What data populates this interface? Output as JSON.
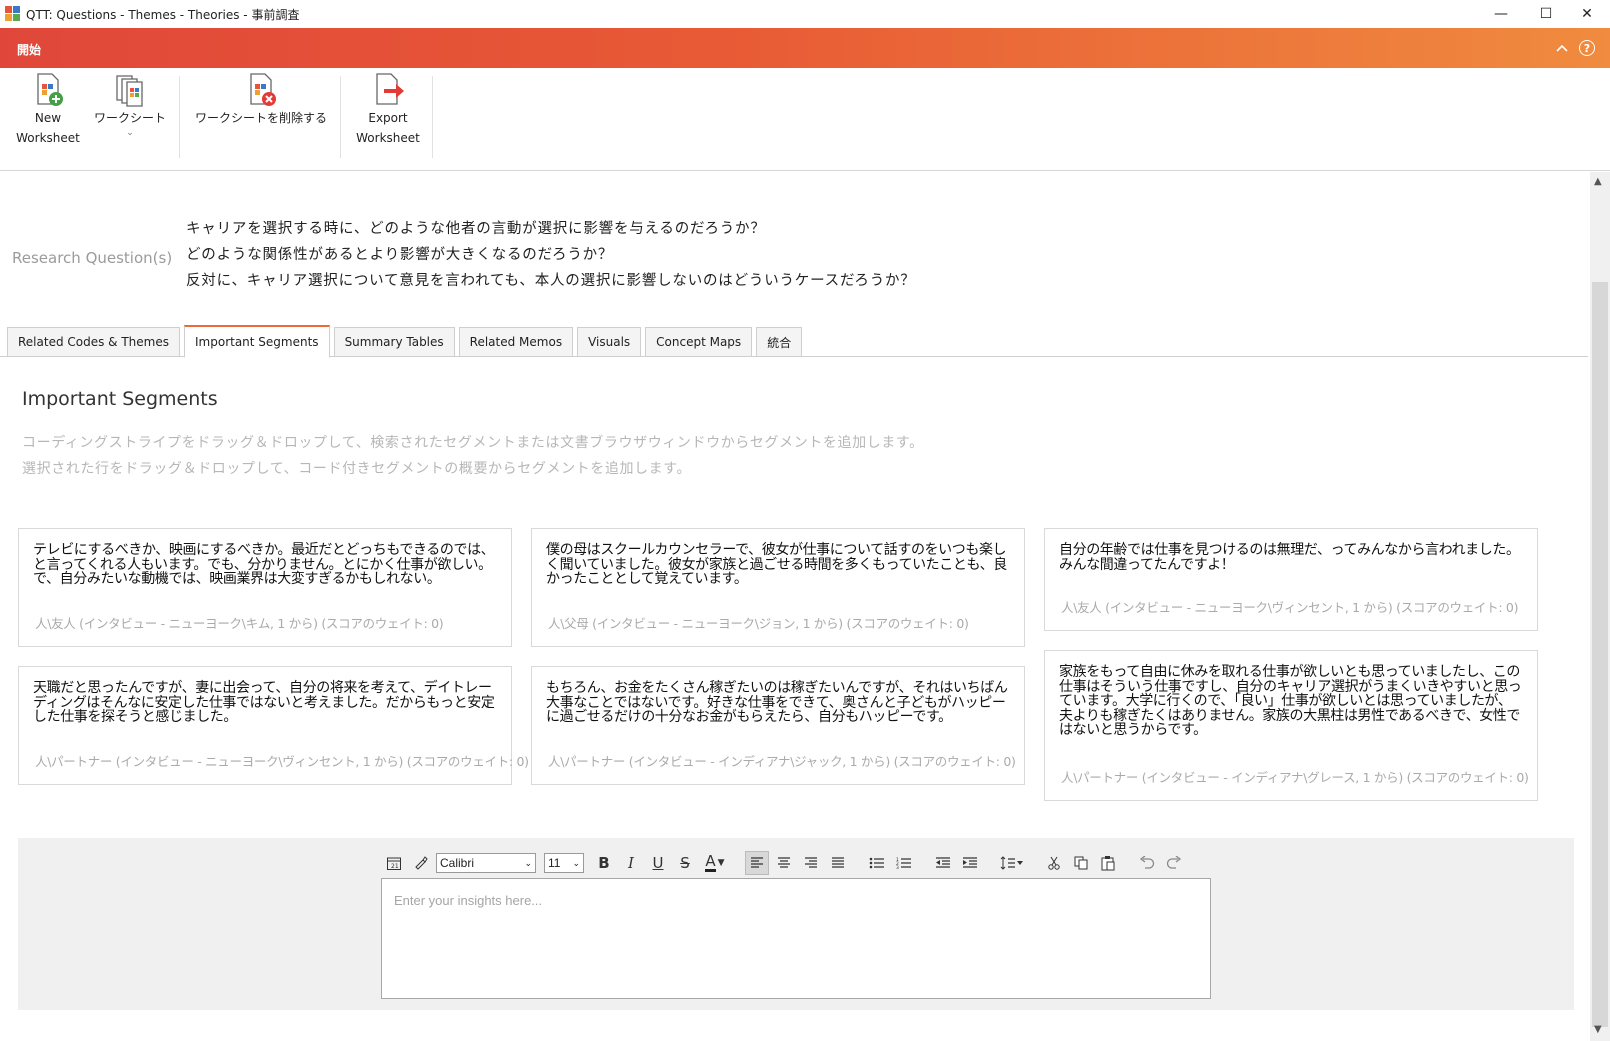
{
  "window": {
    "title": "QTT: Questions - Themes - Theories - 事前調査",
    "controls": {
      "minimize": "—",
      "maximize": "☐",
      "close": "✕"
    }
  },
  "ribbon": {
    "tab_label": "開始",
    "buttons": {
      "new_worksheet": {
        "line1": "New",
        "line2": "Worksheet"
      },
      "worksheet": {
        "line1": "ワークシート",
        "arrow": "⌄"
      },
      "delete_worksheet": {
        "line1": "ワークシートを削除する"
      },
      "export_worksheet": {
        "line1": "Export",
        "line2": "Worksheet"
      }
    }
  },
  "research": {
    "label": "Research Question(s)",
    "questions": [
      "キャリアを選択する時に、どのような他者の言動が選択に影響を与えるのだろうか？",
      "どのような関係性があるとより影響が大きくなるのだろうか？",
      "反対に、キャリア選択について意見を言われても、本人の選択に影響しないのはどういうケースだろうか？"
    ]
  },
  "tabs": [
    {
      "label": "Related Codes & Themes",
      "active": false
    },
    {
      "label": "Important Segments",
      "active": true
    },
    {
      "label": "Summary Tables",
      "active": false
    },
    {
      "label": "Related Memos",
      "active": false
    },
    {
      "label": "Visuals",
      "active": false
    },
    {
      "label": "Concept Maps",
      "active": false
    },
    {
      "label": "統合",
      "active": false
    }
  ],
  "segments": {
    "title": "Important Segments",
    "hint_lines": [
      "コーディングストライプをドラッグ＆ドロップして、検索されたセグメントまたは文書ブラウザウィンドウからセグメントを追加します。",
      "選択された行をドラッグ＆ドロップして、コード付きセグメントの概要からセグメントを追加します。"
    ],
    "cards": [
      {
        "text": "テレビにするべきか、映画にするべきか。最近だとどっちもできるのでは、と言ってくれる人もいます。でも、分かりません。とにかく仕事が欲しい。で、自分みたいな動機では、映画業界は大変すぎるかもしれない。",
        "source": "人\\友人 (インタビュー - ニューヨーク\\キム, 1 から) (スコアのウェイト: 0)"
      },
      {
        "text": "僕の母はスクールカウンセラーで、彼女が仕事について話すのをいつも楽しく聞いていました。彼女が家族と過ごせる時間を多くもっていたことも、良かったこととして覚えています。",
        "source": "人\\父母 (インタビュー - ニューヨーク\\ジョン, 1 から) (スコアのウェイト: 0)"
      },
      {
        "text": "自分の年齢では仕事を見つけるのは無理だ、ってみんなから言われました。みんな間違ってたんですよ！",
        "source": "人\\友人 (インタビュー - ニューヨーク\\ヴィンセント, 1 から) (スコアのウェイト: 0)"
      },
      {
        "text": "天職だと思ったんですが、妻に出会って、自分の将来を考えて、デイトレーディングはそんなに安定した仕事ではないと考えました。だからもっと安定した仕事を探そうと感じました。",
        "source": "人\\パートナー (インタビュー - ニューヨーク\\ヴィンセント, 1 から) (スコアのウェイト: 0)"
      },
      {
        "text": "もちろん、お金をたくさん稼ぎたいのは稼ぎたいんですが、それはいちばん大事なことではないです。好きな仕事をできて、奥さんと子どもがハッピーに過ごせるだけの十分なお金がもらえたら、自分もハッピーです。",
        "source": "人\\パートナー (インタビュー - インディアナ\\ジャック, 1 から) (スコアのウェイト: 0)"
      },
      {
        "text": "家族をもって自由に休みを取れる仕事が欲しいとも思っていましたし、この仕事はそういう仕事ですし、自分のキャリア選択がうまくいきやすいと思っています。大学に行くので、「良い」仕事が欲しいとは思っていましたが、夫よりも稼ぎたくはありません。家族の大黒柱は男性であるべきで、女性ではないと思うからです。",
        "source": "人\\パートナー (インタビュー - インディアナ\\グレース, 1 から) (スコアのウェイト: 0)"
      }
    ]
  },
  "editor": {
    "font_name": "Calibri",
    "font_size": "11",
    "placeholder": "Enter your insights here...",
    "icons": [
      "calendar-icon",
      "format-painter-icon",
      "bold-icon",
      "italic-icon",
      "underline-icon",
      "strikethrough-icon",
      "font-color-icon",
      "align-left-icon",
      "align-center-icon",
      "align-right-icon",
      "justify-icon",
      "bullet-list-icon",
      "numbered-list-icon",
      "outdent-icon",
      "indent-icon",
      "line-spacing-icon",
      "cut-icon",
      "copy-icon",
      "paste-icon",
      "undo-icon",
      "redo-icon"
    ]
  }
}
